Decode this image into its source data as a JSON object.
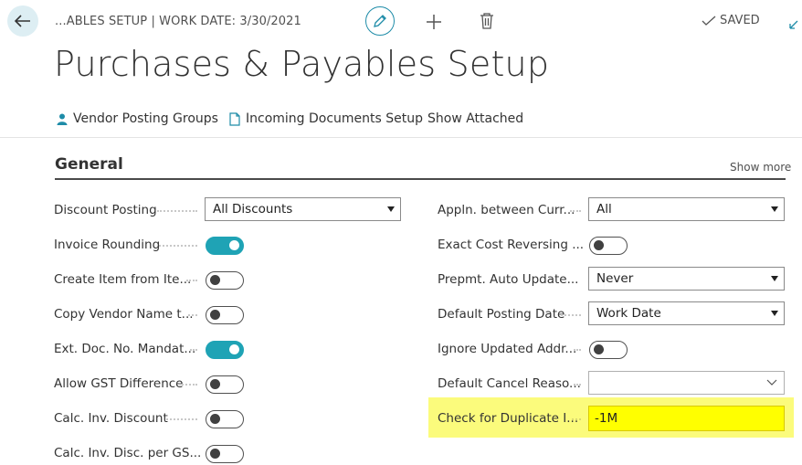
{
  "header": {
    "breadcrumb": "...ABLES SETUP | WORK DATE: 3/30/2021",
    "saved_status": "SAVED"
  },
  "page": {
    "title": "Purchases & Payables Setup"
  },
  "actions": [
    {
      "label": "Vendor Posting Groups",
      "icon": "person-icon"
    },
    {
      "label": "Incoming Documents Setup",
      "icon": "document-icon"
    },
    {
      "label": "Show Attached"
    }
  ],
  "section": {
    "title": "General",
    "show_more": "Show more"
  },
  "left_fields": [
    {
      "label": "Discount Posting",
      "type": "select",
      "value": "All Discounts"
    },
    {
      "label": "Invoice Rounding",
      "type": "toggle",
      "value": true
    },
    {
      "label": "Create Item from Ite...",
      "type": "toggle",
      "value": false
    },
    {
      "label": "Copy Vendor Name t...",
      "type": "toggle",
      "value": false
    },
    {
      "label": "Ext. Doc. No. Mandat...",
      "type": "toggle",
      "value": true
    },
    {
      "label": "Allow GST Difference",
      "type": "toggle",
      "value": false
    },
    {
      "label": "Calc. Inv. Discount",
      "type": "toggle",
      "value": false
    },
    {
      "label": "Calc. Inv. Disc. per GS...",
      "type": "toggle",
      "value": false
    }
  ],
  "right_fields": [
    {
      "label": "Appln. between Curr...",
      "type": "select",
      "value": "All"
    },
    {
      "label": "Exact Cost Reversing ...",
      "type": "toggle",
      "value": false
    },
    {
      "label": "Prepmt. Auto Update...",
      "type": "select",
      "value": "Never"
    },
    {
      "label": "Default Posting Date",
      "type": "select",
      "value": "Work Date"
    },
    {
      "label": "Ignore Updated Addr...",
      "type": "toggle",
      "value": false
    },
    {
      "label": "Default Cancel Reaso...",
      "type": "lookup",
      "value": ""
    },
    {
      "label": "Check for Duplicate I...",
      "type": "input",
      "value": "-1M"
    }
  ],
  "colors": {
    "accent": "#1fa3b5",
    "highlight": "#fbfb7c",
    "input_highlight": "#ffff00"
  }
}
